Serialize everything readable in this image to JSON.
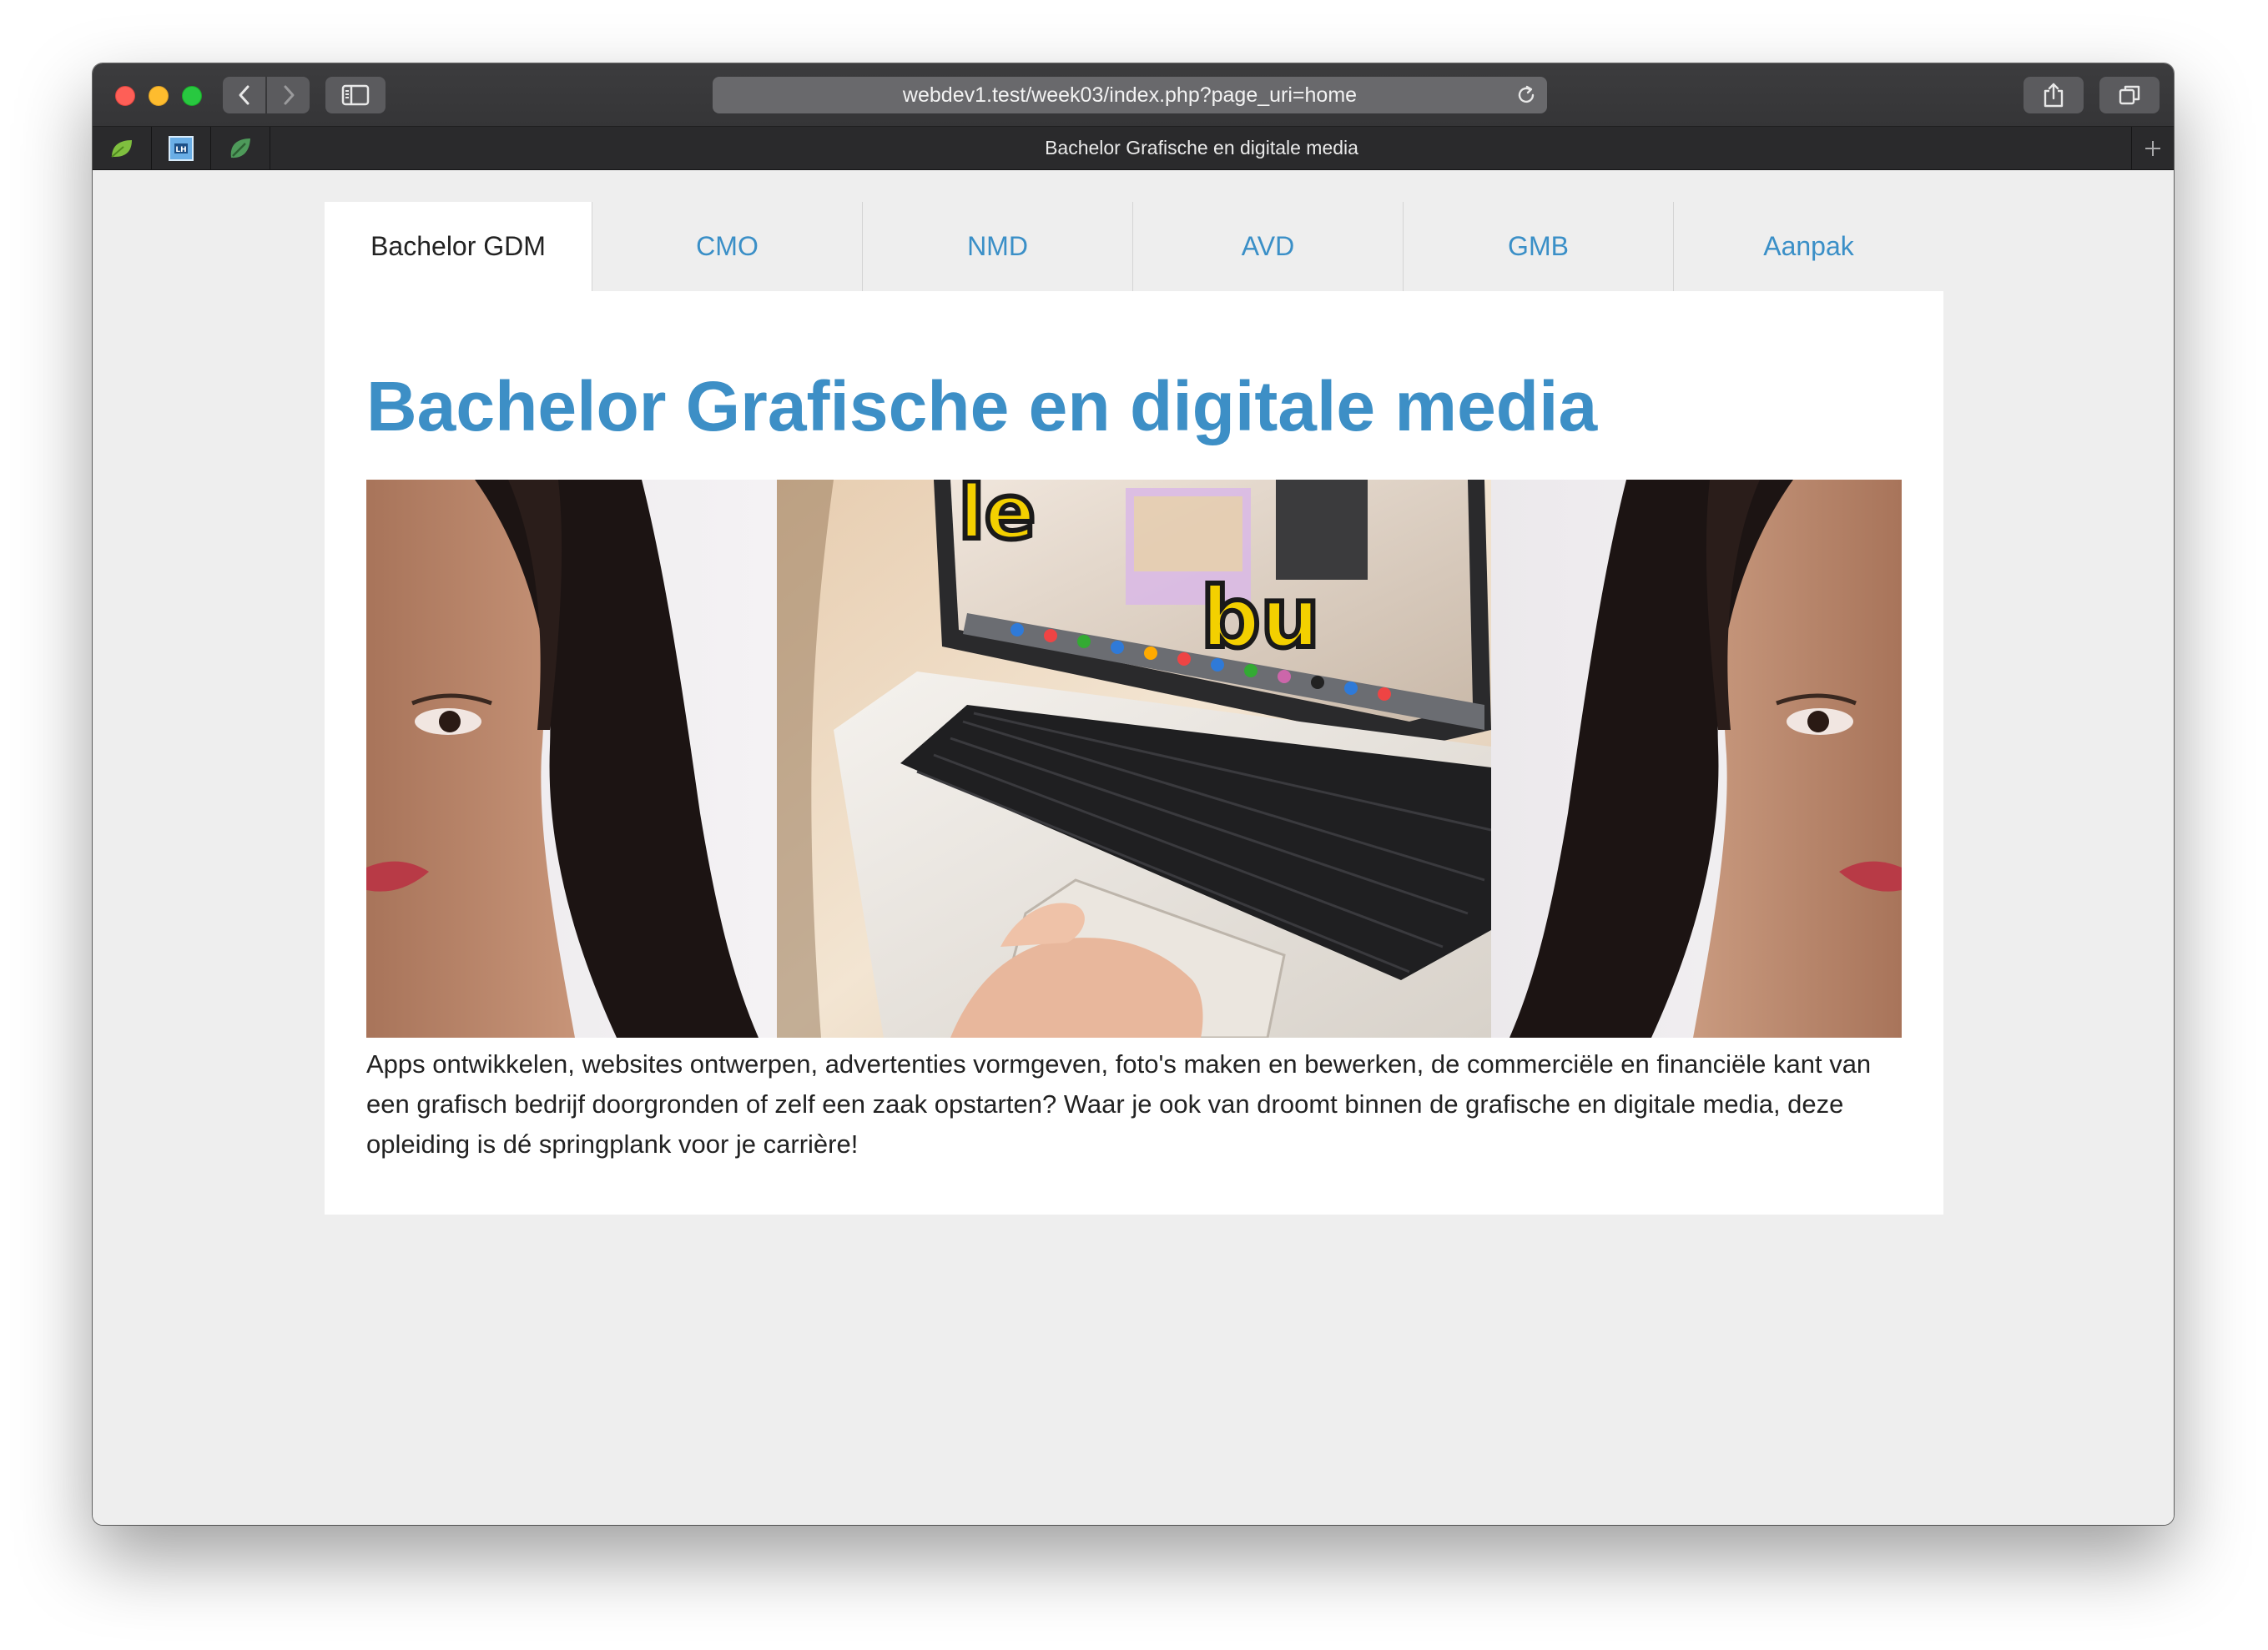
{
  "browser": {
    "address": "webdev1.test/week03/index.php?page_uri=home",
    "tab_title": "Bachelor Grafische en digitale media",
    "favorites": [
      "leaf-green-icon",
      "lh-icon",
      "leaf-dark-icon"
    ]
  },
  "site": {
    "nav": [
      {
        "label": "Bachelor GDM",
        "active": true
      },
      {
        "label": "CMO",
        "active": false
      },
      {
        "label": "NMD",
        "active": false
      },
      {
        "label": "AVD",
        "active": false
      },
      {
        "label": "GMB",
        "active": false
      },
      {
        "label": "Aanpak",
        "active": false
      }
    ],
    "title": "Bachelor Grafische en digitale media",
    "hero_image": "portrait-laptop-collage",
    "intro": "Apps ontwikkelen, websites ontwerpen, advertenties vormgeven, foto's maken en bewerken, de commerciële en financiële kant van een grafisch bedrijf doorgronden of zelf een zaak opstarten? Waar je ook van droomt binnen de grafische en digitale media, deze opleiding is dé springplank voor je carrière!"
  },
  "colors": {
    "link": "#3a8fc7",
    "title": "#3d8fc6",
    "page_bg": "#eeeeee"
  }
}
